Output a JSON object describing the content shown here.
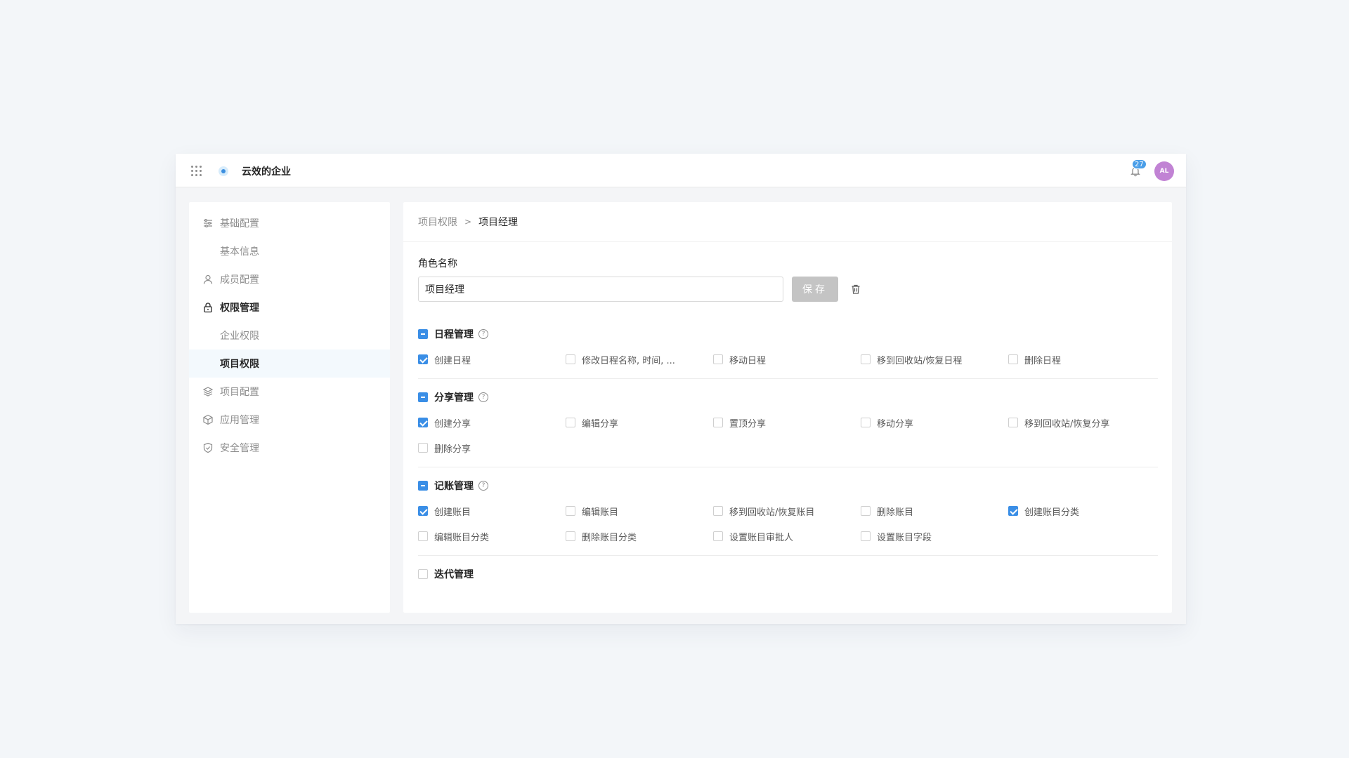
{
  "colors": {
    "accent": "#3a8ee6",
    "badge": "#4a9ee8",
    "avatar": "#c183d4"
  },
  "topbar": {
    "apps_icon": "grid-dots-icon",
    "org_name": "云效的企业",
    "notification_count": "27",
    "avatar_initials": "AL"
  },
  "sidebar": {
    "items": [
      {
        "label": "基础配置",
        "icon": "sliders-icon"
      },
      {
        "label": "基本信息"
      },
      {
        "label": "成员配置",
        "icon": "user-icon"
      },
      {
        "label": "权限管理",
        "icon": "lock-icon"
      },
      {
        "label": "企业权限"
      },
      {
        "label": "项目权限"
      },
      {
        "label": "项目配置",
        "icon": "layers-icon"
      },
      {
        "label": "应用管理",
        "icon": "cube-icon"
      },
      {
        "label": "安全管理",
        "icon": "shield-icon"
      }
    ]
  },
  "breadcrumb": {
    "parent": "项目权限",
    "separator": ">",
    "current": "项目经理"
  },
  "role": {
    "label": "角色名称",
    "value": "项目经理",
    "save_label": "保存"
  },
  "sections": [
    {
      "title": "日程管理",
      "state": "indeterminate",
      "perms": [
        {
          "label": "创建日程",
          "checked": true
        },
        {
          "label": "修改日程名称, 时间, ...",
          "checked": false
        },
        {
          "label": "移动日程",
          "checked": false
        },
        {
          "label": "移到回收站/恢复日程",
          "checked": false
        },
        {
          "label": "删除日程",
          "checked": false
        }
      ]
    },
    {
      "title": "分享管理",
      "state": "indeterminate",
      "perms": [
        {
          "label": "创建分享",
          "checked": true
        },
        {
          "label": "编辑分享",
          "checked": false
        },
        {
          "label": "置顶分享",
          "checked": false
        },
        {
          "label": "移动分享",
          "checked": false
        },
        {
          "label": "移到回收站/恢复分享",
          "checked": false
        },
        {
          "label": "删除分享",
          "checked": false
        }
      ]
    },
    {
      "title": "记账管理",
      "state": "indeterminate",
      "perms": [
        {
          "label": "创建账目",
          "checked": true
        },
        {
          "label": "编辑账目",
          "checked": false
        },
        {
          "label": "移到回收站/恢复账目",
          "checked": false
        },
        {
          "label": "删除账目",
          "checked": false
        },
        {
          "label": "创建账目分类",
          "checked": true
        },
        {
          "label": "编辑账目分类",
          "checked": false
        },
        {
          "label": "删除账目分类",
          "checked": false
        },
        {
          "label": "设置账目审批人",
          "checked": false
        },
        {
          "label": "设置账目字段",
          "checked": false
        }
      ]
    },
    {
      "title": "迭代管理",
      "state": "unchecked",
      "perms": []
    }
  ]
}
